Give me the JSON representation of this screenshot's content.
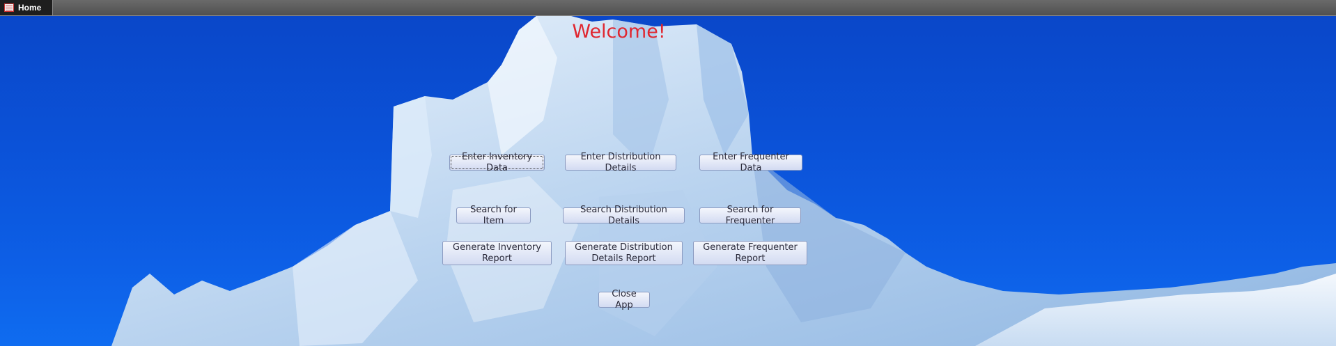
{
  "tab": {
    "label": "Home",
    "icon": "form-icon"
  },
  "main": {
    "welcome": "Welcome!",
    "buttons": {
      "enter_inventory": "Enter Inventory Data",
      "enter_distribution": "Enter Distribution Details",
      "enter_frequenter": "Enter Frequenter Data",
      "search_item": "Search for Item",
      "search_distribution": "Search Distribution Details",
      "search_frequenter": "Search for Frequenter",
      "generate_inventory": "Generate Inventory Report",
      "generate_distribution": "Generate Distribution Details Report",
      "generate_frequenter": "Generate Frequenter Report",
      "close_app": "Close App"
    }
  },
  "colors": {
    "welcome": "#e0262f",
    "sky": "#0b52d8",
    "ice": "#cfe2f5"
  }
}
